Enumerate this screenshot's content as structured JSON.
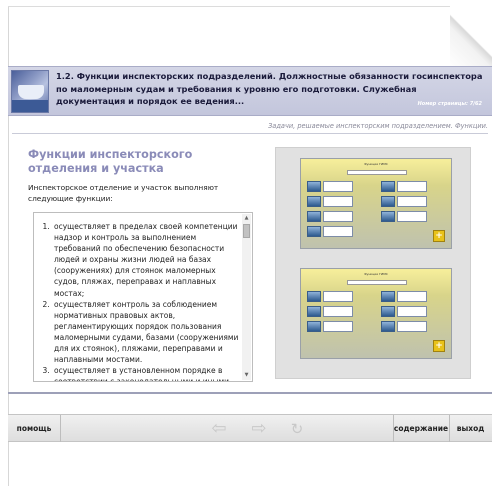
{
  "header": {
    "title": "1.2. Функции инспекторских подразделений. Должностные обязанности госинспектора по маломерным судам и требования к уровню его подготовки. Служебная документация и порядок ее ведения...",
    "page_number": "Номер страницы: 7/62"
  },
  "subtitle": "Задачи, решаемые инспекторским подразделением. Функции.",
  "content": {
    "section_title": "Функции инспекторского отделения и участка",
    "intro": "Инспекторское отделение и участок выполняют следующие функции:",
    "list_items": [
      "осуществляет в пределах своей компетенции надзор и контроль за выполнением требований по обеспечению безопасности людей и охраны жизни людей на базах (сооружениях) для стоянок маломерных судов, пляжах, переправах и наплавных мостах;",
      "осуществляет контроль за соблюдением нормативных правовых актов, регламентирующих порядок пользования маломерными судами, базами (сооружениями для их стоянок), пляжами, переправами и наплавными мостами.",
      "осуществляет в установленном порядке в соответствии с законодательными и иными"
    ]
  },
  "images": {
    "slide_1_heading": "Функции ГИМС",
    "slide_2_heading": "Функции ГИМС"
  },
  "toolbar": {
    "help": "помощь",
    "contents": "содержание",
    "exit": "выход",
    "back_icon": "arrow-left-icon",
    "forward_icon": "arrow-right-icon",
    "reload_icon": "reload-icon"
  },
  "colors": {
    "header_bg": "#c8cadf",
    "section_title": "#8a8bb8",
    "disabled_icon": "#c8c8c8"
  }
}
